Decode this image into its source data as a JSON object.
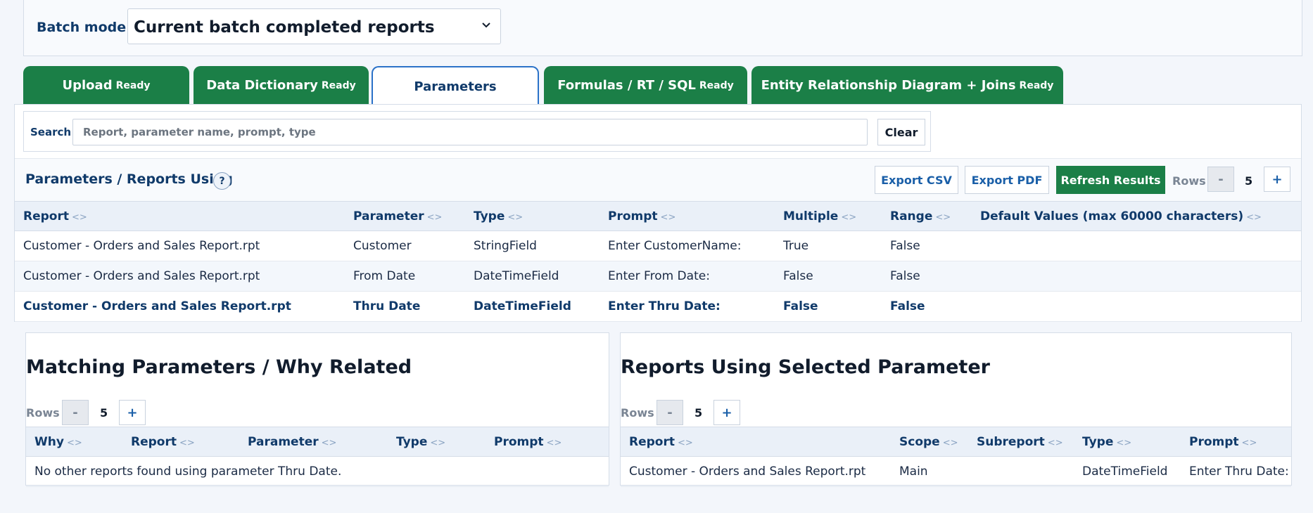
{
  "batch": {
    "label": "Batch mode",
    "selected": "Current batch completed reports"
  },
  "tabs": [
    {
      "label": "Upload",
      "status": "Ready"
    },
    {
      "label": "Data Dictionary",
      "status": "Ready"
    },
    {
      "label": "Parameters",
      "status": ""
    },
    {
      "label": "Formulas / RT / SQL",
      "status": "Ready"
    },
    {
      "label": "Entity Relationship Diagram + Joins",
      "status": "Ready"
    }
  ],
  "search": {
    "label": "Search",
    "placeholder": "Report, parameter name, prompt, type",
    "value": "",
    "clear_label": "Clear"
  },
  "params_section": {
    "title": "Parameters / Reports Using",
    "help": "?",
    "export_csv": "Export CSV",
    "export_pdf": "Export PDF",
    "refresh": "Refresh Results",
    "rows_label": "Rows",
    "rows_minus": "-",
    "rows_value": "5",
    "rows_plus": "+",
    "sort_glyph": "<>",
    "columns": [
      "Report",
      "Parameter",
      "Type",
      "Prompt",
      "Multiple",
      "Range",
      "Default Values (max 60000 characters)"
    ],
    "rows": [
      [
        "Customer - Orders and Sales Report.rpt",
        "Customer",
        "StringField",
        "Enter CustomerName:",
        "True",
        "False",
        ""
      ],
      [
        "Customer - Orders and Sales Report.rpt",
        "From Date",
        "DateTimeField",
        "Enter From Date:",
        "False",
        "False",
        ""
      ],
      [
        "Customer - Orders and Sales Report.rpt",
        "Thru Date",
        "DateTimeField",
        "Enter Thru Date:",
        "False",
        "False",
        ""
      ]
    ]
  },
  "matching": {
    "title": "Matching Parameters / Why Related",
    "rows_label": "Rows",
    "rows_minus": "-",
    "rows_value": "5",
    "rows_plus": "+",
    "columns": [
      "Why",
      "Report",
      "Parameter",
      "Type",
      "Prompt"
    ],
    "empty_message": "No other reports found using parameter Thru Date."
  },
  "reports_using": {
    "title": "Reports Using Selected Parameter",
    "rows_label": "Rows",
    "rows_minus": "-",
    "rows_value": "5",
    "rows_plus": "+",
    "columns": [
      "Report",
      "Scope",
      "Subreport",
      "Type",
      "Prompt"
    ],
    "rows": [
      [
        "Customer - Orders and Sales Report.rpt",
        "Main",
        "",
        "DateTimeField",
        "Enter Thru Date:"
      ]
    ]
  },
  "colors": {
    "tab_green": "#1b7f47",
    "accent_blue": "#103a6a",
    "link_blue": "#1a5fa8"
  }
}
